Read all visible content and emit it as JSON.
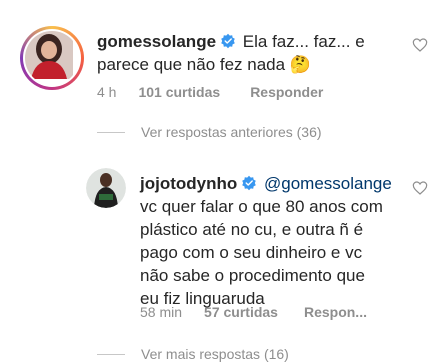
{
  "comment1": {
    "username": "gomessolange",
    "text_line1": "Ela faz... faz... e",
    "text_line2": "parece que não fez nada",
    "emoji": "🤔",
    "time": "4 h",
    "likes": "101 curtidas",
    "reply": "Responder"
  },
  "view_previous": "Ver respostas anteriores (36)",
  "reply1": {
    "username": "jojotodynho",
    "mention": "@gomessolange",
    "lines": [
      "vc quer falar o que 80 anos com",
      "plástico até  no cu, e outra ñ é",
      "pago com o seu dinheiro e vc",
      "não sabe o  procedimento que",
      "eu fiz linguaruda"
    ],
    "time": "58 min",
    "likes": "57 curtidas",
    "reply": "Respon..."
  },
  "view_more": "Ver mais respostas (16)",
  "colors": {
    "text": "#262626",
    "secondary": "#8e8e8e",
    "verified": "#3897f0",
    "mention": "#00376b"
  }
}
